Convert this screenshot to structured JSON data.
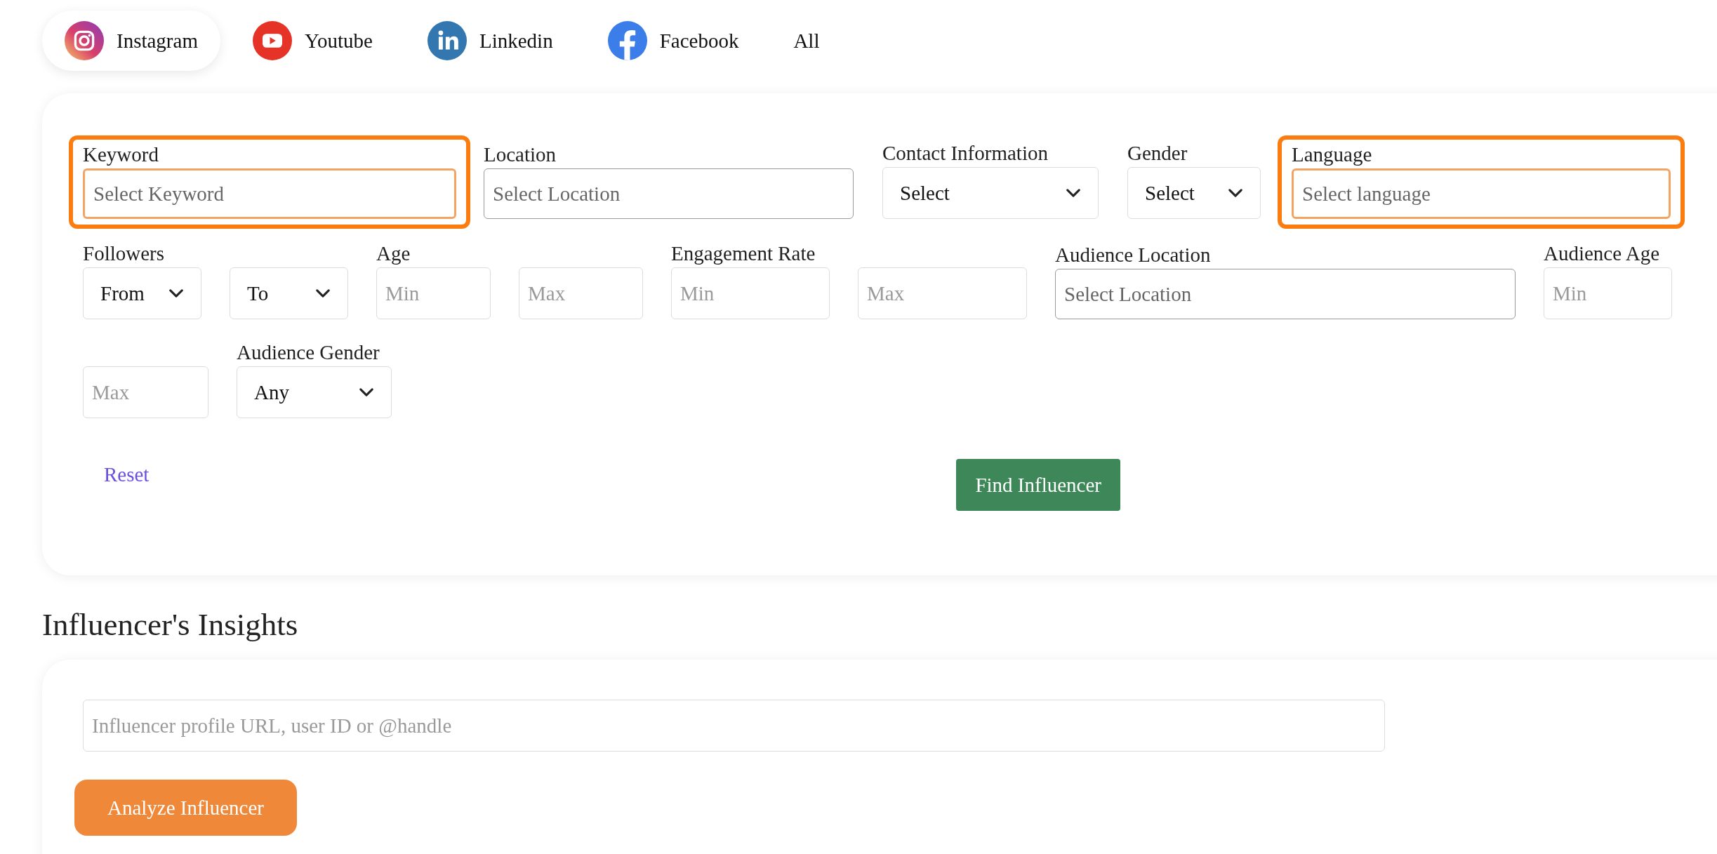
{
  "platform_tabs": [
    {
      "kind": "instagram",
      "label": "Instagram",
      "selected": true
    },
    {
      "kind": "youtube",
      "label": "Youtube",
      "selected": false
    },
    {
      "kind": "linkedin",
      "label": "Linkedin",
      "selected": false
    },
    {
      "kind": "facebook",
      "label": "Facebook",
      "selected": false
    },
    {
      "kind": "none",
      "label": "All",
      "selected": false
    }
  ],
  "filters": {
    "rows": [
      [
        {
          "label": "Keyword",
          "highlighted": true,
          "controls": [
            {
              "kind": "input",
              "placeholder": "Select Keyword"
            }
          ]
        },
        {
          "label": "Location",
          "highlighted": false,
          "controls": [
            {
              "kind": "input",
              "placeholder": "Select Location"
            }
          ]
        },
        {
          "label": "Contact Information",
          "highlighted": false,
          "controls": [
            {
              "kind": "select",
              "value": "Select"
            }
          ]
        },
        {
          "label": "Gender",
          "highlighted": false,
          "controls": [
            {
              "kind": "select",
              "value": "Select"
            }
          ]
        },
        {
          "label": "Language",
          "highlighted": true,
          "controls": [
            {
              "kind": "input",
              "placeholder": "Select language"
            }
          ]
        }
      ],
      [
        {
          "label": "Followers",
          "highlighted": false,
          "controls": [
            {
              "kind": "select",
              "value": "From"
            },
            {
              "kind": "select",
              "value": "To"
            }
          ]
        },
        {
          "label": "Age",
          "highlighted": false,
          "controls": [
            {
              "kind": "input",
              "placeholder": "Min"
            },
            {
              "kind": "input",
              "placeholder": "Max"
            }
          ]
        },
        {
          "label": "Engagement Rate",
          "highlighted": false,
          "controls": [
            {
              "kind": "input",
              "placeholder": "Min"
            },
            {
              "kind": "input",
              "placeholder": "Max"
            }
          ]
        },
        {
          "label": "Audience Location",
          "highlighted": false,
          "controls": [
            {
              "kind": "input",
              "placeholder": "Select Location"
            }
          ]
        },
        {
          "label": "Audience Age",
          "highlighted": false,
          "controls": [
            {
              "kind": "input",
              "placeholder": "Min"
            }
          ]
        }
      ],
      [
        {
          "highlighted": false,
          "controls": [
            {
              "kind": "input",
              "placeholder": "Max"
            }
          ]
        },
        {
          "label": "Audience Gender",
          "highlighted": false,
          "controls": [
            {
              "kind": "select",
              "value": "Any"
            }
          ]
        }
      ]
    ],
    "reset": "Reset",
    "submit": "Find Influencer"
  },
  "insights": {
    "title": "Influencer's Insights",
    "url_field": {
      "placeholder": "Influencer profile URL, user ID or @handle"
    },
    "button": "Analyze Influencer"
  }
}
